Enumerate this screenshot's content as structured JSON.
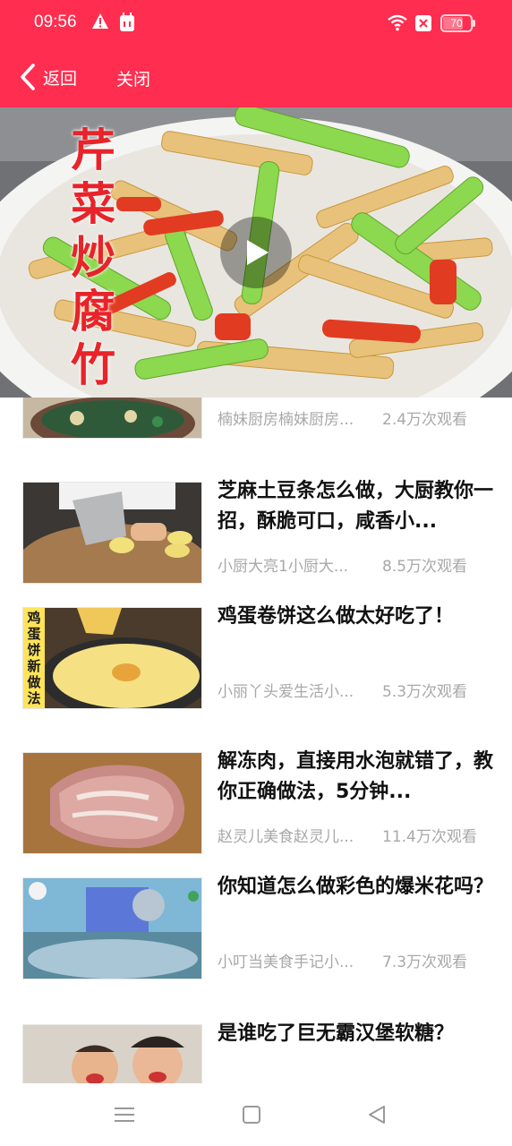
{
  "status_bar": {
    "time": "09:56",
    "battery": "70",
    "battery_level": 0.7,
    "icons": [
      "warning-icon",
      "android-icon",
      "wifi-icon",
      "sim-off-icon",
      "battery-icon"
    ]
  },
  "nav": {
    "back_label": "返回",
    "close_label": "关闭"
  },
  "video": {
    "overlay_title": "芹菜炒腐竹",
    "play_icon": "play-icon"
  },
  "list": {
    "items": [
      {
        "title": "",
        "author": "楠妹厨房楠妹厨房...",
        "views": "2.4万次观看"
      },
      {
        "title": "芝麻土豆条怎么做，大厨教你一招，酥脆可口，咸香小...",
        "author": "小厨大亮1小厨大...",
        "views": "8.5万次观看"
      },
      {
        "title": "鸡蛋卷饼这么做太好吃了！",
        "author": "小丽丫头爱生活小...",
        "views": "5.3万次观看",
        "thumb_text": "鸡蛋饼新做法"
      },
      {
        "title": "解冻肉，直接用水泡就错了，教你正确做法，5分钟...",
        "author": "赵灵儿美食赵灵儿...",
        "views": "11.4万次观看"
      },
      {
        "title": "你知道怎么做彩色的爆米花吗？",
        "author": "小叮当美食手记小...",
        "views": "7.3万次观看"
      },
      {
        "title": "是谁吃了巨无霸汉堡软糖？",
        "author": "",
        "views": ""
      }
    ]
  },
  "system_nav": {
    "icons": [
      "menu-icon",
      "home-icon",
      "back-triangle-icon"
    ]
  },
  "colors": {
    "brand": "#ff2d4f",
    "title_text": "#111111",
    "meta_text": "#a8a8a8"
  }
}
